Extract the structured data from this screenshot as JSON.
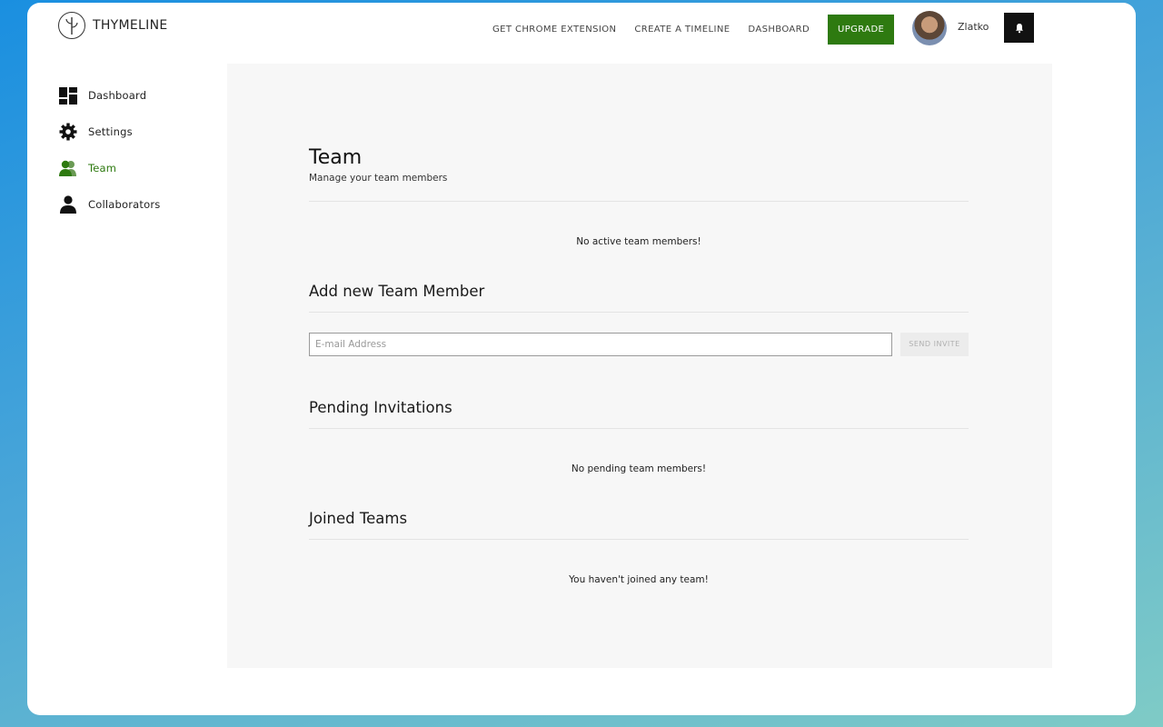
{
  "brand": {
    "name": "THYMELINE",
    "logo_icon": "sprout-logo-icon"
  },
  "nav": {
    "links": [
      "GET CHROME EXTENSION",
      "CREATE A TIMELINE",
      "DASHBOARD"
    ],
    "upgrade_label": "UPGRADE",
    "user_name": "Zlatko",
    "bell_icon": "bell-icon"
  },
  "sidebar": {
    "items": [
      {
        "label": "Dashboard",
        "icon": "dashboard-grid-icon",
        "active": false
      },
      {
        "label": "Settings",
        "icon": "gear-icon",
        "active": false
      },
      {
        "label": "Team",
        "icon": "team-icon",
        "active": true
      },
      {
        "label": "Collaborators",
        "icon": "person-icon",
        "active": false
      }
    ]
  },
  "team": {
    "title": "Team",
    "subtitle": "Manage your team members",
    "no_members": "No active team members!"
  },
  "add_member": {
    "title": "Add new Team Member",
    "email_placeholder": "E-mail Address",
    "send_label": "SEND INVITE"
  },
  "pending": {
    "title": "Pending Invitations",
    "empty": "No pending team members!"
  },
  "joined": {
    "title": "Joined Teams",
    "empty": "You haven't joined any team!"
  },
  "colors": {
    "accent": "#2e7a10",
    "panel": "#f7f7f7"
  }
}
